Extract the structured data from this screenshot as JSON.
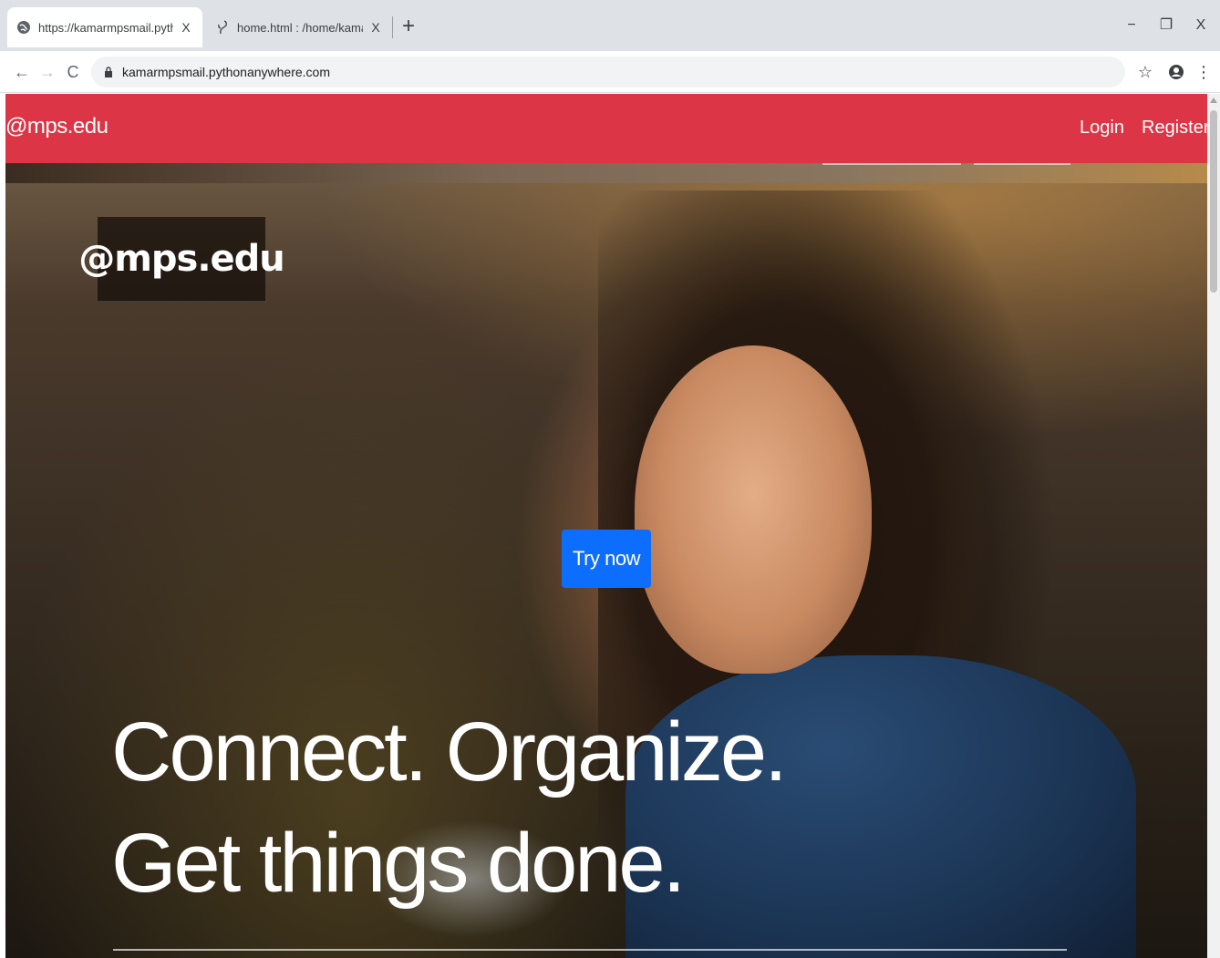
{
  "browser": {
    "tabs": [
      {
        "title": "https://kamarmpsmail.pythonany",
        "active": true,
        "icon": "globe-icon"
      },
      {
        "title": "home.html : /home/kamarmpsm",
        "active": false,
        "icon": "python-icon"
      }
    ],
    "tab_close": "X",
    "new_tab": "+",
    "window_controls": {
      "minimize": "−",
      "maximize": "❐",
      "close": "X"
    },
    "address": "kamarmpsmail.pythonanywhere.com"
  },
  "site": {
    "nav_color": "#dc3545",
    "brand": "@mps.edu",
    "nav_links": [
      "Login",
      "Register"
    ]
  },
  "hero": {
    "logo": "@mps.edu",
    "cta": "Try now",
    "cta_color": "#0d6efd",
    "headline_line1": "Connect. Organize.",
    "headline_line2": "Get things done."
  }
}
